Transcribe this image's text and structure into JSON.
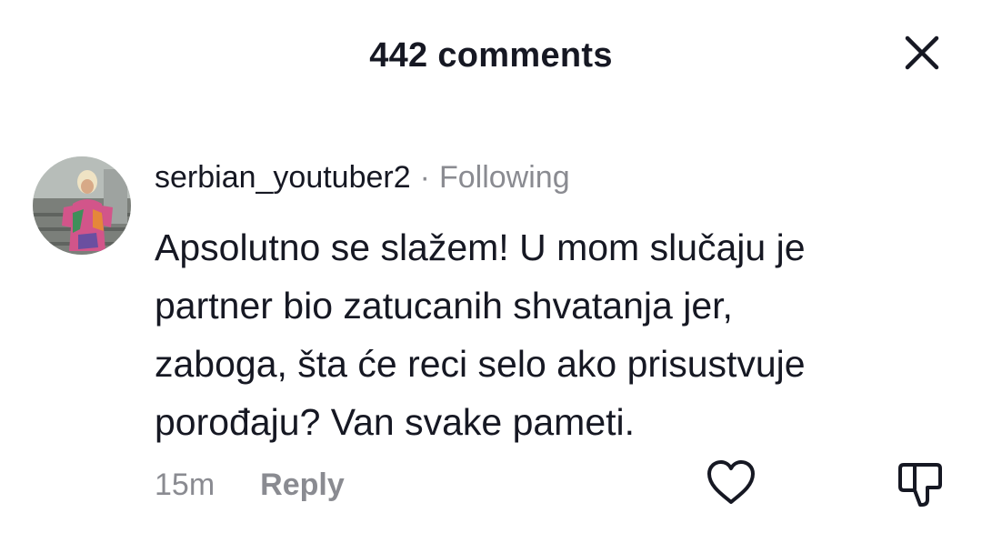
{
  "header": {
    "title": "442 comments",
    "close_icon": "close-icon"
  },
  "comment": {
    "avatar_icon": "user-avatar",
    "username": "serbian_youtuber2",
    "separator": "·",
    "follow_status": "Following",
    "lines": [
      "Apsolutno se slažem! U mom slučaju je",
      "partner bio zatucanih shvatanja jer,",
      "zaboga, šta će reci selo ako prisustvuje",
      "porođaju? Van svake pameti."
    ],
    "time": "15m",
    "reply_label": "Reply",
    "like_icon": "heart-outline-icon",
    "dislike_icon": "thumbs-down-icon"
  },
  "colors": {
    "text_primary": "#161823",
    "text_secondary": "#8a8b91",
    "background": "#ffffff"
  }
}
